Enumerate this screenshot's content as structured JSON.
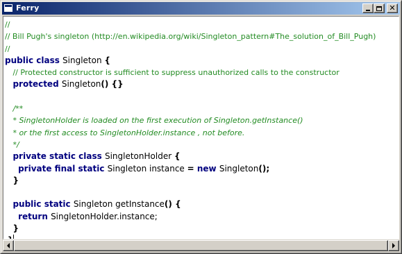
{
  "window": {
    "title": "Ferry",
    "buttons": {
      "minimize": "minimize",
      "maximize": "maximize",
      "close": "close"
    }
  },
  "editor": {
    "lines": [
      [
        {
          "t": "cm",
          "v": "//"
        }
      ],
      [
        {
          "t": "cm",
          "v": "// Bill Pugh's singleton (http://en.wikipedia.org/wiki/Singleton_pattern#The_solution_of_Bill_Pugh)"
        }
      ],
      [
        {
          "t": "cm",
          "v": "//"
        }
      ],
      [
        {
          "t": "kw",
          "v": "public class "
        },
        {
          "t": "id",
          "v": "Singleton "
        },
        {
          "t": "op",
          "v": "{"
        }
      ],
      [
        {
          "t": "id",
          "v": "   "
        },
        {
          "t": "cm",
          "v": "// Protected constructor is sufficient to suppress unauthorized calls to the constructor"
        }
      ],
      [
        {
          "t": "id",
          "v": "   "
        },
        {
          "t": "kw",
          "v": "protected "
        },
        {
          "t": "id",
          "v": "Singleton"
        },
        {
          "t": "op",
          "v": "() {}"
        }
      ],
      [
        {
          "t": "id",
          "v": ""
        }
      ],
      [
        {
          "t": "id",
          "v": "   "
        },
        {
          "t": "cmd",
          "v": "/**"
        }
      ],
      [
        {
          "t": "id",
          "v": "   "
        },
        {
          "t": "cmd",
          "v": "* SingletonHolder is loaded on the first execution of Singleton.getInstance()"
        }
      ],
      [
        {
          "t": "id",
          "v": "   "
        },
        {
          "t": "cmd",
          "v": "* or the first access to SingletonHolder.instance , not before."
        }
      ],
      [
        {
          "t": "id",
          "v": "   "
        },
        {
          "t": "cmd",
          "v": "*/"
        }
      ],
      [
        {
          "t": "id",
          "v": "   "
        },
        {
          "t": "kw",
          "v": "private static class "
        },
        {
          "t": "id",
          "v": "SingletonHolder "
        },
        {
          "t": "op",
          "v": "{"
        }
      ],
      [
        {
          "t": "id",
          "v": "     "
        },
        {
          "t": "kw",
          "v": "private final static "
        },
        {
          "t": "id",
          "v": "Singleton instance "
        },
        {
          "t": "op",
          "v": "= "
        },
        {
          "t": "kw",
          "v": "new "
        },
        {
          "t": "id",
          "v": "Singleton"
        },
        {
          "t": "op",
          "v": "();"
        }
      ],
      [
        {
          "t": "id",
          "v": "   "
        },
        {
          "t": "op",
          "v": "}"
        }
      ],
      [
        {
          "t": "id",
          "v": ""
        }
      ],
      [
        {
          "t": "id",
          "v": "   "
        },
        {
          "t": "kw",
          "v": "public static "
        },
        {
          "t": "id",
          "v": "Singleton getInstance"
        },
        {
          "t": "op",
          "v": "() {"
        }
      ],
      [
        {
          "t": "id",
          "v": "     "
        },
        {
          "t": "kw",
          "v": "return "
        },
        {
          "t": "id",
          "v": "SingletonHolder.instance;"
        }
      ],
      [
        {
          "t": "id",
          "v": "   "
        },
        {
          "t": "op",
          "v": "}"
        }
      ],
      [
        {
          "t": "id",
          "v": " "
        },
        {
          "t": "op",
          "v": "}"
        },
        {
          "t": "caret",
          "v": ""
        }
      ]
    ]
  },
  "scrollbar": {
    "position": 0,
    "visible_fraction": 1.0
  }
}
